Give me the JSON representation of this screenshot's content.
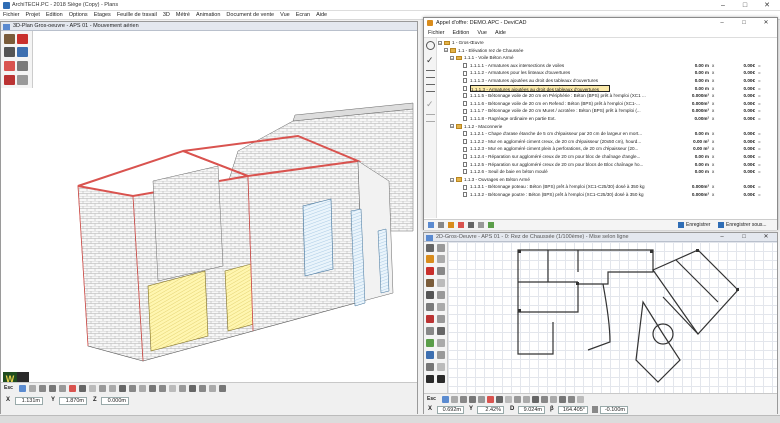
{
  "app": {
    "title": "ArchiTECH.PC - 2018 Siège (Copy) - Plans",
    "menu": [
      "Fichier",
      "Projet",
      "Edition",
      "Options",
      "Etages",
      "Feuille de travail",
      "3D",
      "Métré",
      "Animation",
      "Document de vente",
      "Vue",
      "Ecran",
      "Aide"
    ],
    "accent": "#2f6db5"
  },
  "view3d": {
    "title": "3D-Plan Gros-oeuvre - APS 01 - Mouvement aérien",
    "status": {
      "esc_label": "Esc",
      "x_label": "X",
      "x_value": "1.131m",
      "y_label": "Y",
      "y_value": "1.870m",
      "z_label": "Z",
      "z_value": "0.000m"
    }
  },
  "devis": {
    "title": "Appel d'offre: DEMO.APC - DeviCAD",
    "menu": [
      "Fichier",
      "Edition",
      "Vue",
      "Aide"
    ],
    "rows": [
      {
        "code": "1 - Gros-Œuvre",
        "desc": "",
        "qty": "",
        "unit": "",
        "price": "",
        "cur": "",
        "level": 0,
        "type": "folder"
      },
      {
        "code": "1.1 - Elévation rez de Chaussée",
        "desc": "",
        "qty": "",
        "unit": "",
        "price": "",
        "cur": "",
        "level": 1,
        "type": "folder"
      },
      {
        "code": "1.1.1 - Voile Béton Armé",
        "desc": "",
        "qty": "",
        "unit": "",
        "price": "",
        "cur": "",
        "level": 2,
        "type": "folder"
      },
      {
        "code": "1.1.1.1 - Armatures aux intersections de voiles",
        "desc": "",
        "qty": "0.00 m",
        "unit": "x",
        "price": "0.00€",
        "cur": "=",
        "level": 3,
        "type": "doc"
      },
      {
        "code": "1.1.1.2 - Armatures pour les linteaux d'ouvertures",
        "desc": "",
        "qty": "0.00 m",
        "unit": "x",
        "price": "0.00€",
        "cur": "=",
        "level": 3,
        "type": "doc"
      },
      {
        "code": "1.1.1.3 - Armatures ajoutées au droit des tableaux d'ouvertures",
        "desc": "",
        "qty": "0.00 m",
        "unit": "x",
        "price": "0.00€",
        "cur": "=",
        "level": 3,
        "type": "doc"
      },
      {
        "code": "1.1.1.3 - Armatures ajoutées au droit des tableaux d'ouvertures",
        "desc": "",
        "qty": "0.00 m",
        "unit": "x",
        "price": "0.00€",
        "cur": "=",
        "level": 3,
        "type": "doc",
        "selected": true
      },
      {
        "code": "1.1.1.5 - Bétonnage voile de 20 cm en Périphérie : Béton (BPS) prêt à l'emploi (XC1 ...",
        "desc": "",
        "qty": "0.000m³",
        "unit": "x",
        "price": "0.00€",
        "cur": "=",
        "level": 3,
        "type": "doc"
      },
      {
        "code": "1.1.1.6 - Bétonnage voile de 20 cm en Refend : Béton (BPS) prêt à l'emploi (XC1-...",
        "desc": "",
        "qty": "0.000m³",
        "unit": "x",
        "price": "0.00€",
        "cur": "=",
        "level": 3,
        "type": "doc"
      },
      {
        "code": "1.1.1.7 - Bétonnage voile de 20 cm Muret / acrotère : Béton (BPS) prêt à l'emploi (...",
        "desc": "",
        "qty": "0.000m³",
        "unit": "x",
        "price": "0.00€",
        "cur": "=",
        "level": 3,
        "type": "doc"
      },
      {
        "code": "1.1.1.8 - Ragréage ordinaire en partie Ext.",
        "desc": "",
        "qty": "0.00m²",
        "unit": "x",
        "price": "0.00€",
        "cur": "=",
        "level": 3,
        "type": "doc"
      },
      {
        "code": "1.1.2 - Maconnerie",
        "desc": "",
        "qty": "",
        "unit": "",
        "price": "",
        "cur": "",
        "level": 2,
        "type": "folder"
      },
      {
        "code": "1.1.2.1 - Chape d'arase étanche de 5 cm d'épaisseur par 20 cm de largeur en mort...",
        "desc": "",
        "qty": "0.00 m",
        "unit": "x",
        "price": "0.00€",
        "cur": "=",
        "level": 3,
        "type": "doc"
      },
      {
        "code": "1.1.2.2 - Mur en aggloméré ciment creux, de 20 cm d'épaisseur (20x50 cm), hourd...",
        "desc": "",
        "qty": "0.00 m²",
        "unit": "x",
        "price": "0.00€",
        "cur": "=",
        "level": 3,
        "type": "doc"
      },
      {
        "code": "1.1.2.3 - Mur en aggloméré ciment plein à perforations, de 20 cm d'épaisseur (20...",
        "desc": "",
        "qty": "0.00 m²",
        "unit": "x",
        "price": "0.00€",
        "cur": "=",
        "level": 3,
        "type": "doc"
      },
      {
        "code": "1.1.2.4 - Réparation sur aggloméré creux de 20 cm pour bloc de chaînage d'angle...",
        "desc": "",
        "qty": "0.00 m",
        "unit": "x",
        "price": "0.00€",
        "cur": "=",
        "level": 3,
        "type": "doc"
      },
      {
        "code": "1.1.2.5 - Réparation sur aggloméré creux de 20 cm pour blocs de Bloc chaînage ho...",
        "desc": "",
        "qty": "0.00 m",
        "unit": "x",
        "price": "0.00€",
        "cur": "=",
        "level": 3,
        "type": "doc"
      },
      {
        "code": "1.1.2.6 - Seuil de baie en béton moulé",
        "desc": "",
        "qty": "0.00 m",
        "unit": "x",
        "price": "0.00€",
        "cur": "=",
        "level": 3,
        "type": "doc"
      },
      {
        "code": "1.1.3 - Ouvrages en Béton Armé",
        "desc": "",
        "qty": "",
        "unit": "",
        "price": "",
        "cur": "",
        "level": 2,
        "type": "folder"
      },
      {
        "code": "1.1.3.1 - Bétonnage poteau : Béton (BPS) prêt à l'emploi (XC1-C25/30) dosé à 350 kg",
        "desc": "",
        "qty": "0.000m³",
        "unit": "x",
        "price": "0.00€",
        "cur": "=",
        "level": 3,
        "type": "doc"
      },
      {
        "code": "1.1.3.2 - Bétonnage poutre : Béton (BPS) prêt à l'emploi (XC1-C25/30) dosé à 350 kg",
        "desc": "",
        "qty": "0.000m³",
        "unit": "x",
        "price": "0.00€",
        "cur": "=",
        "level": 3,
        "type": "doc"
      }
    ],
    "footer": {
      "save_label": "Enregistrer",
      "save_as_label": "Enregistrer sous..."
    }
  },
  "view2d": {
    "title": "2D-Gros-Oeuvre - APS 01 - 0: Rez de Chaussée (1/100ème) - Mise selon ligne",
    "status": {
      "esc_label": "Esc",
      "x_label": "X",
      "x_value": "0.692m",
      "y_label": "Y",
      "y_value": "2.42%",
      "d_label": "D",
      "d_value": "9.024m",
      "b_label": "β",
      "b_value": "164.405°",
      "extra_value": "-0.100m"
    }
  }
}
